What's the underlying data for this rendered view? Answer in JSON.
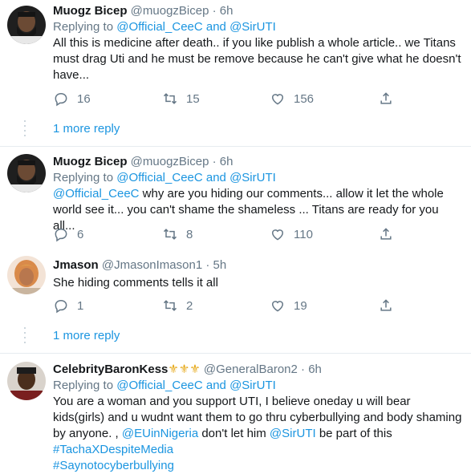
{
  "replying_to_label": "Replying to",
  "more_reply_label": "1 more reply",
  "tweets": [
    {
      "name": "Muogz Bicep",
      "handle": "@muogzBicep",
      "time": "6h",
      "reply_mentions": "@Official_CeeC and @SirUTI",
      "text": "All this is medicine after death.. if you like publish a whole article.. we Titans must drag Uti and he must be remove because he can't give what he doesn't have...",
      "replies": "16",
      "retweets": "15",
      "likes": "156"
    },
    {
      "name": "Muogz Bicep",
      "handle": "@muogzBicep",
      "time": "6h",
      "reply_mentions": "@Official_CeeC and @SirUTI",
      "mention": "@Official_CeeC",
      "text": " why are you hiding our comments... allow it let the whole world see it... you can't shame the shameless ... Titans are ready for you all...",
      "replies": "6",
      "retweets": "8",
      "likes": "110"
    },
    {
      "name": "Jmason",
      "handle": "@JmasonImason1",
      "time": "5h",
      "text": "She hiding comments tells it all",
      "replies": "1",
      "retweets": "2",
      "likes": "19"
    },
    {
      "name": "CelebrityBaronKess",
      "name_emojis": "⚜⚜⚜",
      "handle": "@GeneralBaron2",
      "time": "6h",
      "reply_mentions": "@Official_CeeC and @SirUTI",
      "text_part1": "You are a woman and you support UTI, I believe oneday u will bear kids(girls) and u wudnt want them to go thru cyberbullying and body shaming by anyone. , ",
      "mention1": "@EUinNigeria",
      "text_part2": " don't let him ",
      "mention2": "@SirUTI",
      "text_part3": " be part of this",
      "hashtag1": "#TachaXDespiteMedia",
      "hashtag2": "#Saynotocyberbullying"
    }
  ],
  "colors": {
    "link": "#1b95e0",
    "muted": "#657786",
    "divider": "#e6ecf0"
  },
  "icons": [
    "reply-icon",
    "retweet-icon",
    "like-icon",
    "share-icon"
  ]
}
